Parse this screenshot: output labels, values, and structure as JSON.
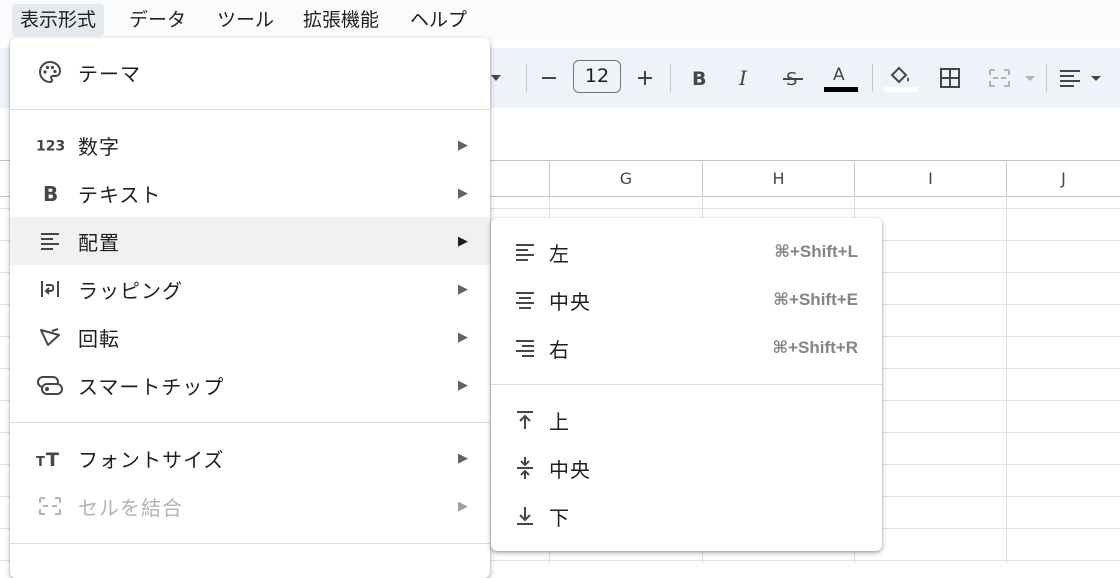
{
  "menubar": {
    "items": [
      {
        "label": "表示形式",
        "active": true
      },
      {
        "label": "データ"
      },
      {
        "label": "ツール"
      },
      {
        "label": "拡張機能"
      },
      {
        "label": "ヘルプ"
      }
    ]
  },
  "toolbar": {
    "font_size": "12",
    "text_color_swatch": "#000000"
  },
  "sheet": {
    "columns": [
      "G",
      "H",
      "I",
      "J"
    ]
  },
  "format_menu": {
    "theme": "テーマ",
    "number": "数字",
    "text": "テキスト",
    "alignment": "配置",
    "wrapping": "ラッピング",
    "rotation": "回転",
    "smart_chips": "スマートチップ",
    "font_size": "フォントサイズ",
    "merge_cells": "セルを結合",
    "arrow": "▶"
  },
  "alignment_submenu": {
    "left": {
      "label": "左",
      "shortcut": "⌘+Shift+L"
    },
    "center": {
      "label": "中央",
      "shortcut": "⌘+Shift+E"
    },
    "right": {
      "label": "右",
      "shortcut": "⌘+Shift+R"
    },
    "top": {
      "label": "上"
    },
    "middle": {
      "label": "中央"
    },
    "bottom": {
      "label": "下"
    }
  },
  "colors": {
    "hover": "#f0f1f3",
    "toolbar_bg": "#eef2f9",
    "menubar_bg": "#f9fbfd",
    "disabled_text": "#b0b4b8"
  }
}
